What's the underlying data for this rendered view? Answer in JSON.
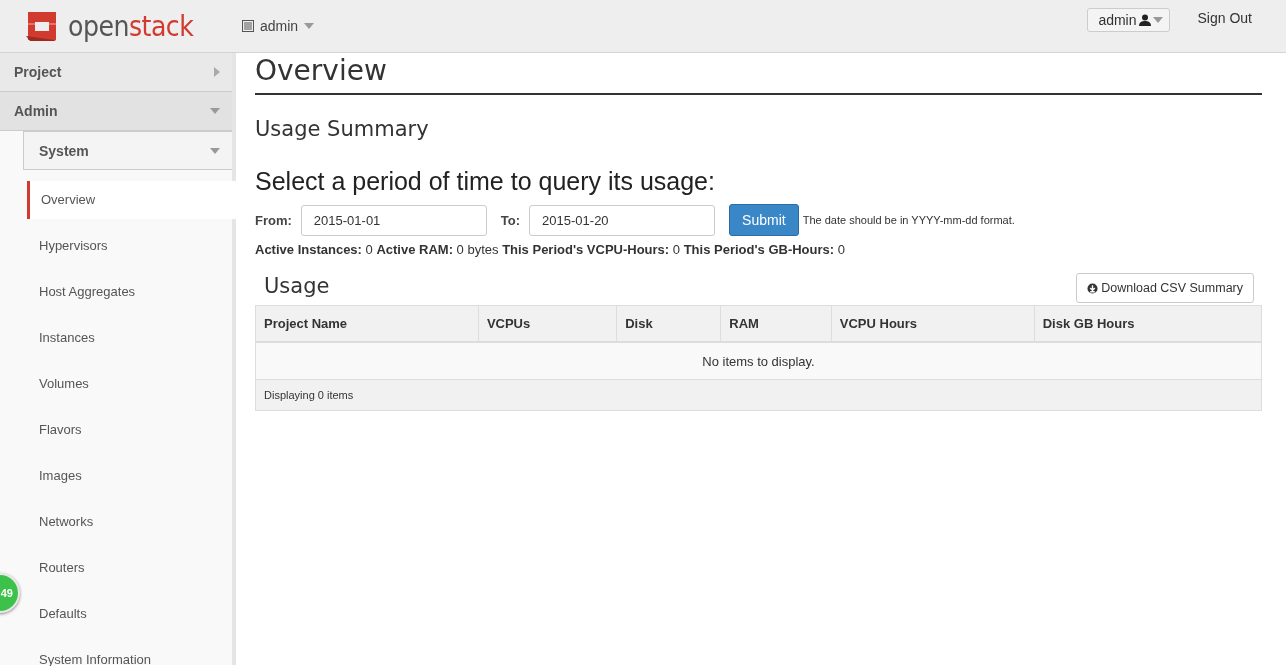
{
  "header": {
    "logo": {
      "plain": "open",
      "accent": "stack"
    },
    "project_menu": {
      "label": "admin"
    },
    "user_menu": {
      "label": "admin"
    },
    "sign_out": "Sign Out"
  },
  "sidebar": {
    "dashboards": [
      {
        "label": "Project",
        "expanded": false
      },
      {
        "label": "Admin",
        "expanded": true
      }
    ],
    "panel_group": {
      "label": "System",
      "expanded": true
    },
    "items": [
      {
        "label": "Overview",
        "selected": true
      },
      {
        "label": "Hypervisors",
        "selected": false
      },
      {
        "label": "Host Aggregates",
        "selected": false
      },
      {
        "label": "Instances",
        "selected": false
      },
      {
        "label": "Volumes",
        "selected": false
      },
      {
        "label": "Flavors",
        "selected": false
      },
      {
        "label": "Images",
        "selected": false
      },
      {
        "label": "Networks",
        "selected": false
      },
      {
        "label": "Routers",
        "selected": false
      },
      {
        "label": "Defaults",
        "selected": false
      },
      {
        "label": "System Information",
        "selected": false
      }
    ]
  },
  "floating_badge": "49",
  "page": {
    "title": "Overview",
    "subtitle": "Usage Summary",
    "query_heading": "Select a period of time to query its usage:",
    "from": {
      "label": "From:",
      "value": "2015-01-01"
    },
    "to": {
      "label": "To:",
      "value": "2015-01-20"
    },
    "submit": "Submit",
    "hint": "The date should be in YYYY-mm-dd format.",
    "stats": "**Active Instances:** 0 **Active RAM:** 0 bytes **This Period's VCPU-Hours:** 0 **This Period's GB-Hours:** 0",
    "usage": {
      "title": "Usage",
      "download": "Download CSV Summary",
      "columns": [
        "Project Name",
        "VCPUs",
        "Disk",
        "RAM",
        "VCPU Hours",
        "Disk GB Hours"
      ],
      "empty": "No items to display.",
      "footer": "Displaying 0 items"
    }
  }
}
